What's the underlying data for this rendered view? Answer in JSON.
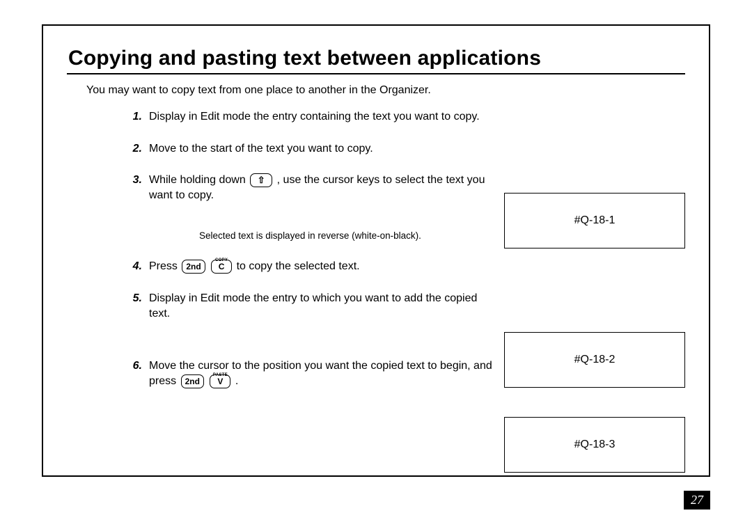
{
  "title": "Copying and pasting text between applications",
  "intro": "You may want to copy text from one place to another in the Organizer.",
  "steps": {
    "s1": {
      "num": "1.",
      "text": "Display in Edit mode the entry containing the text you want to copy."
    },
    "s2": {
      "num": "2.",
      "text": "Move to the start of the text you want to copy."
    },
    "s3": {
      "num": "3.",
      "pre": "While holding down ",
      "post": " , use the cursor keys to select the text you want to copy."
    },
    "s4": {
      "num": "4.",
      "pre": "Press ",
      "post": " to copy the selected text."
    },
    "s5": {
      "num": "5.",
      "text": "Display in Edit mode the entry to which you want to add the copied text."
    },
    "s6": {
      "num": "6.",
      "pre": "Move the cursor to the position you want the copied text to begin, and press ",
      "post": " ."
    }
  },
  "note": "Selected text is displayed in reverse (white-on-black).",
  "keys": {
    "shift": "⇧",
    "second": "2nd",
    "c": "C",
    "c_sup": "COPY",
    "v": "V",
    "v_sup": "PASTE"
  },
  "figures": {
    "f1": "#Q-18-1",
    "f2": "#Q-18-2",
    "f3": "#Q-18-3"
  },
  "page_number": "27"
}
